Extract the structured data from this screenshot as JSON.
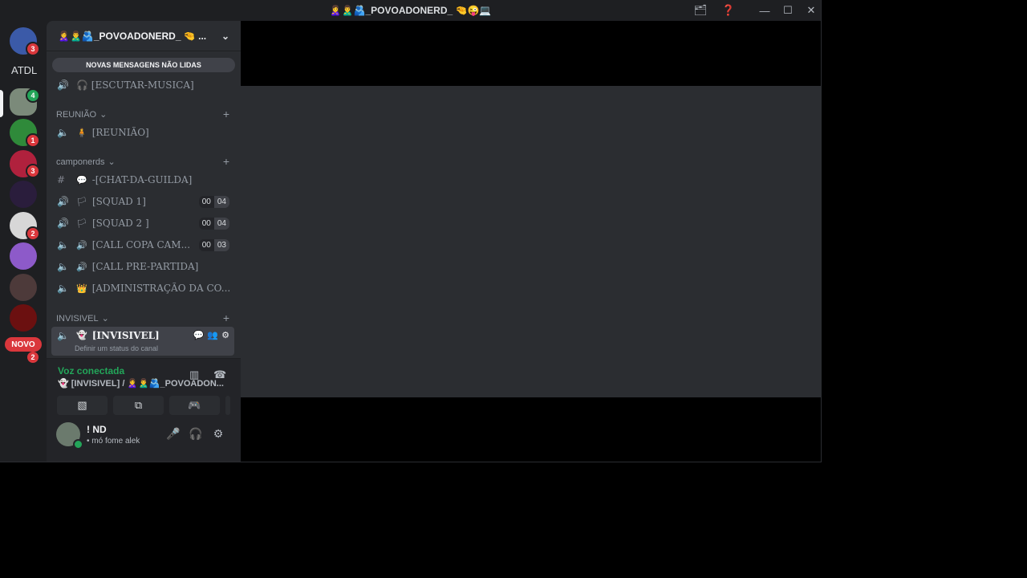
{
  "window": {
    "title": "🙎‍♀️🙎‍♂️🫂_POVOADONERD_ 🤏😜💻",
    "inbox_icon": "inbox-icon",
    "help_icon": "help-icon",
    "min": "—",
    "max": "☐",
    "close": "✕"
  },
  "servers": {
    "badges": [
      "3",
      "4",
      "1",
      "3",
      "2",
      "2"
    ],
    "text_label": "ATDL",
    "novo": "NOVO"
  },
  "channels": {
    "server_name": "🙎‍♀️🙎‍♂️🫂_POVOADONERD_ 🤏 ...",
    "new_messages": "NOVAS MENSAGENS NÃO LIDAS",
    "escutar": "🎧 [ESCUTAR-MUSICA]",
    "cat_reuniao": "REUNIÃO",
    "reuniao": "[REUNIÃO]",
    "cat_camponerds": "camponerds",
    "chat_guilda": "-[CHAT-DA-GUILDA]",
    "squad1": "[SQUAD 1]",
    "squad1_a": "00",
    "squad1_b": "04",
    "squad2": "[SQUAD 2 ]",
    "squad2_a": "00",
    "squad2_b": "04",
    "callcopa": "[CALL COPA CAM...",
    "callcopa_a": "00",
    "callcopa_b": "03",
    "prepartida": "[CALL PRE-PARTIDA]",
    "admin": "[ADMINISTRAÇÃO DA CO...",
    "cat_invisivel": "INVISIVEL",
    "invisivel": "[INVISIVEL]",
    "invisivel_status": "Definir um status do canal"
  },
  "voice": {
    "title": "Voz conectada",
    "channel": "👻 [INVISIVEL] / 🙎‍♀️🙎‍♂️🫂_POVOADON..."
  },
  "user": {
    "name": "! ND",
    "status": "• mó fome alek"
  },
  "colors": {
    "accent_green": "#23a559",
    "badge_red": "#da373c"
  }
}
